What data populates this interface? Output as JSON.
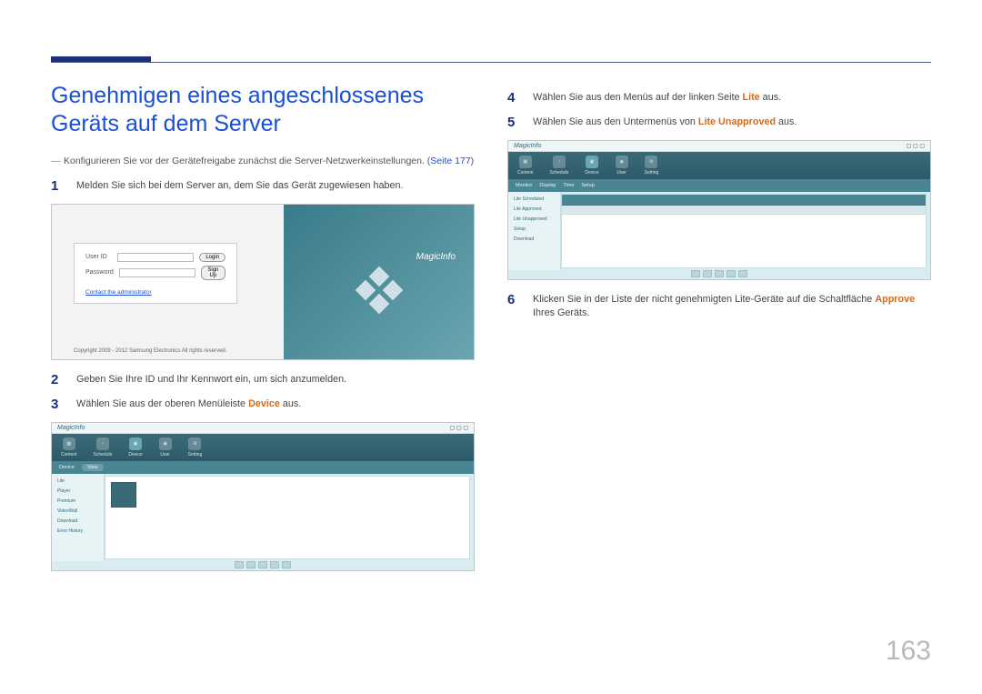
{
  "page_number": "163",
  "title": "Genehmigen eines angeschlossenes Geräts auf dem Server",
  "lead_text": "Konfigurieren Sie vor der Gerätefreigabe zunächst die Server-Netzwerkeinstellungen. (",
  "lead_link": "Seite 177",
  "lead_tail": ")",
  "left_steps": {
    "s1": "Melden Sie sich bei dem Server an, dem Sie das Gerät zugewiesen haben.",
    "s2": "Geben Sie Ihre ID und Ihr Kennwort ein, um sich anzumelden.",
    "s3_pre": "Wählen Sie aus der oberen Menüleiste ",
    "s3_hl": "Device",
    "s3_post": " aus."
  },
  "right_steps": {
    "s4_pre": "Wählen Sie aus den Menüs auf der linken Seite ",
    "s4_hl": "Lite",
    "s4_post": " aus.",
    "s5_pre": "Wählen Sie aus den Untermenüs von ",
    "s5_hl": "Lite Unapproved",
    "s5_post": " aus.",
    "s6_pre": "Klicken Sie in der Liste der nicht genehmigten Lite-Geräte auf die Schaltfläche ",
    "s6_hl": "Approve",
    "s6_post": " Ihres Geräts."
  },
  "login": {
    "brand": "MagicInfo",
    "user_label": "User ID",
    "pass_label": "Password",
    "login_btn": "Login",
    "signup_btn": "Sign Up",
    "contact": "Contact the administrator",
    "copyright": "Copyright 2009 - 2012 Samsung Electronics All rights reserved."
  },
  "app": {
    "brand": "MagicInfo",
    "toolbar": [
      "Content",
      "Schedule",
      "Device",
      "User",
      "Setting"
    ],
    "subtab_device": "Device",
    "subtabs_lite": [
      "Monitor",
      "Display",
      "Time",
      "Setup"
    ],
    "side_device": [
      "Lite",
      "Player",
      "Premium",
      "VideoWall",
      "Download",
      "Error History"
    ],
    "side_lite": [
      "Lite Scheduled",
      "Lite Approved",
      "Lite Unapproved",
      "Setup",
      "Download"
    ],
    "pill_view": "View"
  }
}
